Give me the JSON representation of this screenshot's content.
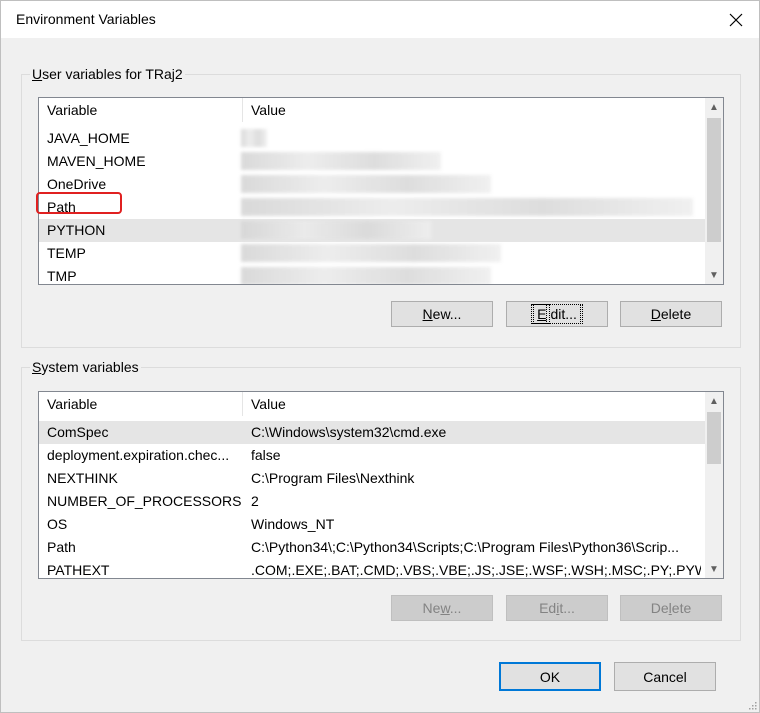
{
  "window": {
    "title": "Environment Variables"
  },
  "user_vars": {
    "group_label_prefix": "",
    "group_label_u": "U",
    "group_label_rest": "ser variables for TRaj2",
    "headers": {
      "variable": "Variable",
      "value": "Value"
    },
    "rows": [
      {
        "name": "JAVA_HOME",
        "value": ""
      },
      {
        "name": "MAVEN_HOME",
        "value": ""
      },
      {
        "name": "OneDrive",
        "value": ""
      },
      {
        "name": "Path",
        "value": ""
      },
      {
        "name": "PYTHON",
        "value": ""
      },
      {
        "name": "TEMP",
        "value": ""
      },
      {
        "name": "TMP",
        "value": ""
      }
    ],
    "buttons": {
      "new_u": "N",
      "new_rest": "ew...",
      "edit_u": "E",
      "edit_rest": "dit...",
      "delete_u": "D",
      "delete_rest": "elete"
    }
  },
  "system_vars": {
    "group_label_u": "S",
    "group_label_rest": "ystem variables",
    "headers": {
      "variable": "Variable",
      "value": "Value"
    },
    "rows": [
      {
        "name": "ComSpec",
        "value": "C:\\Windows\\system32\\cmd.exe"
      },
      {
        "name": "deployment.expiration.chec...",
        "value": "false"
      },
      {
        "name": "NEXTHINK",
        "value": "C:\\Program Files\\Nexthink"
      },
      {
        "name": "NUMBER_OF_PROCESSORS",
        "value": "2"
      },
      {
        "name": "OS",
        "value": "Windows_NT"
      },
      {
        "name": "Path",
        "value": "C:\\Python34\\;C:\\Python34\\Scripts;C:\\Program Files\\Python36\\Scrip..."
      },
      {
        "name": "PATHEXT",
        "value": ".COM;.EXE;.BAT;.CMD;.VBS;.VBE;.JS;.JSE;.WSF;.WSH;.MSC;.PY;.PYW"
      }
    ],
    "buttons": {
      "new_pre": "Ne",
      "new_u": "w",
      "new_rest": "...",
      "edit_pre": "Ed",
      "edit_u": "i",
      "edit_rest": "t...",
      "delete_pre": "De",
      "delete_u": "l",
      "delete_rest": "ete"
    }
  },
  "dialog_buttons": {
    "ok": "OK",
    "cancel": "Cancel"
  },
  "colors": {
    "highlight": "#e02020",
    "default_button_border": "#0078d7",
    "selected_row": "#e5e5e5"
  }
}
